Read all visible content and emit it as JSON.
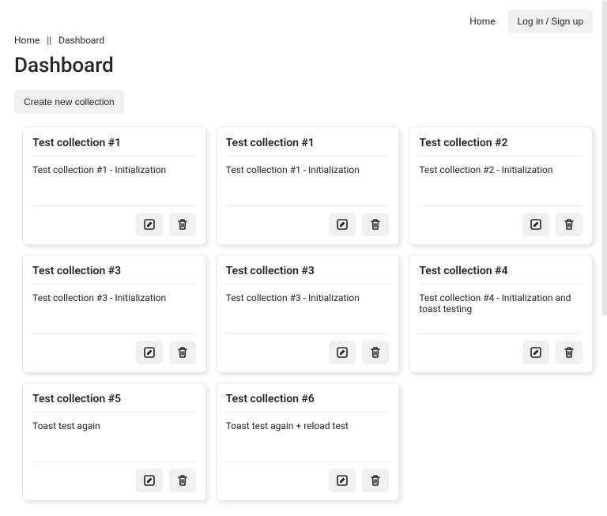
{
  "nav": {
    "home": "Home",
    "login": "Log in / Sign up"
  },
  "breadcrumb": {
    "home": "Home",
    "current": "Dashboard"
  },
  "page_title": "Dashboard",
  "create_button": "Create new collection",
  "collections": [
    {
      "title": "Test collection #1",
      "desc": "Test collection #1 - Initialization"
    },
    {
      "title": "Test collection #1",
      "desc": "Test collection #1 - Initialization"
    },
    {
      "title": "Test collection #2",
      "desc": "Test collection #2 - Initialization"
    },
    {
      "title": "Test collection #3",
      "desc": "Test collection #3 - Initialization"
    },
    {
      "title": "Test collection #3",
      "desc": "Test collection #3 - Initialization"
    },
    {
      "title": "Test collection #4",
      "desc": "Test collection #4 - Initialization and toast testing"
    },
    {
      "title": "Test collection #5",
      "desc": "Toast test again"
    },
    {
      "title": "Test collection #6",
      "desc": "Toast test again + reload test"
    }
  ],
  "icons": {
    "edit": "edit-icon",
    "trash": "trash-icon"
  }
}
